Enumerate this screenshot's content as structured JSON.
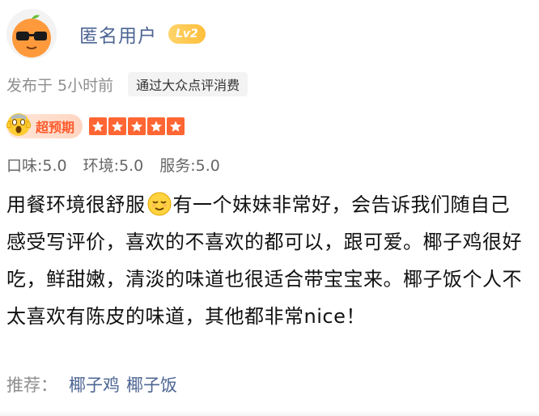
{
  "user": {
    "name": "匿名用户",
    "level": "Lv2",
    "avatar_icon": "orange-with-sunglasses-icon"
  },
  "meta": {
    "post_time": "发布于 5小时前",
    "source": "通过大众点评消费"
  },
  "rating": {
    "badge_label": "超预期",
    "badge_icon": "screaming-face-icon",
    "stars": 5,
    "stars_max": 5,
    "star_color": "#ff6633"
  },
  "scores": [
    {
      "label": "口味:5.0"
    },
    {
      "label": "环境:5.0"
    },
    {
      "label": "服务:5.0"
    }
  ],
  "review": {
    "part1": "用餐环境很舒服",
    "emoji": "relieved-face-icon",
    "part2": "有一个妹妹非常好，会告诉我们随自己感受写评价，喜欢的不喜欢的都可以，跟可爱。椰子鸡很好吃，鲜甜嫩，清淡的味道也很适合带宝宝来。椰子饭个人不太喜欢有陈皮的味道，其他都非常nice！"
  },
  "recommend": {
    "label": "推荐：",
    "dishes": [
      "椰子鸡",
      "椰子饭"
    ]
  },
  "colors": {
    "link": "#4d6593",
    "accent": "#ff6633",
    "muted": "#8e8e8e"
  }
}
